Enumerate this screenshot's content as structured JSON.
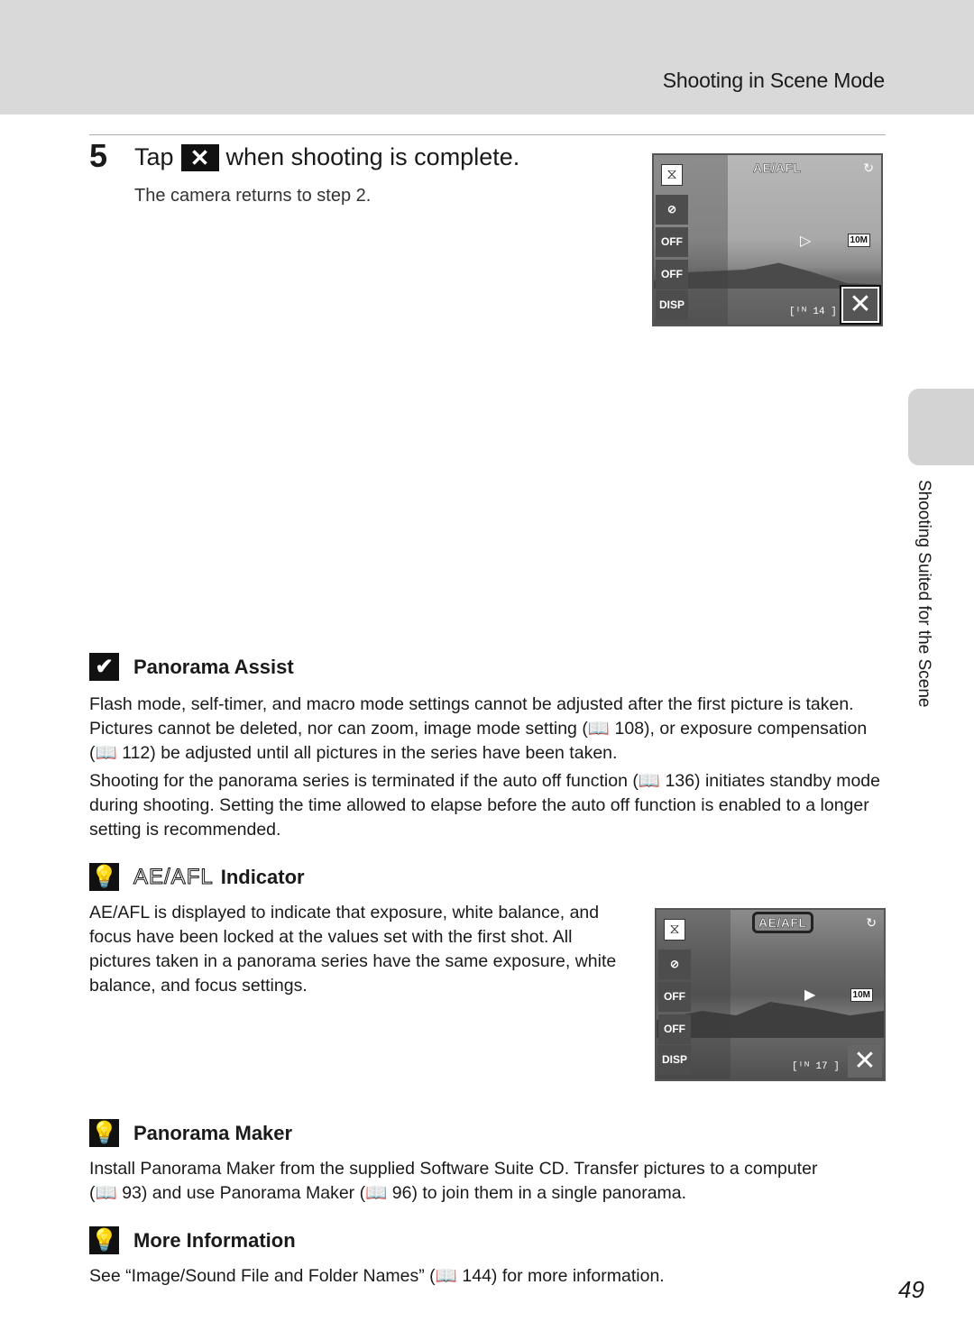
{
  "header": {
    "section_title": "Shooting in Scene Mode"
  },
  "step": {
    "number": "5",
    "title_before": "Tap",
    "title_icon": "✕",
    "title_after": "when shooting is complete.",
    "subtitle": "The camera returns to step 2."
  },
  "camera_screen_1": {
    "ae_label": "AE/AFL",
    "frames_remaining": "[ᴵᴺ  14 ]",
    "image_size": "10M",
    "tiles": [
      "panorama-icon",
      "flash-off-icon",
      "self-timer-off-icon",
      "macro-off-icon",
      "DISP"
    ],
    "disp_label": "DISP",
    "off_label": "OFF"
  },
  "camera_screen_2": {
    "ae_label": "AE/AFL",
    "frames_remaining": "[ᴵᴺ  17 ]",
    "image_size": "10M",
    "disp_label": "DISP",
    "off_label": "OFF"
  },
  "side_tab": {
    "label": "Shooting Suited for the Scene"
  },
  "sections": {
    "panorama_assist": {
      "title": "Panorama Assist",
      "paragraph_1": "Flash mode, self-timer, and macro mode settings cannot be adjusted after the first picture is taken. Pictures cannot be deleted, nor can zoom, image mode setting (📖 108), or exposure compensation (📖 112) be adjusted until all pictures in the series have been taken.",
      "paragraph_2": "Shooting for the panorama series is terminated if the auto off function (📖 136) initiates standby mode during shooting. Setting the time allowed to elapse before the auto off function is enabled to a longer setting is recommended."
    },
    "ae_indicator": {
      "title_glyph": "AE/AFL",
      "title": "Indicator",
      "paragraph": "AE/AFL is displayed to indicate that exposure, white balance, and focus have been locked at the values set with the first shot. All pictures taken in a panorama series have the same exposure, white balance, and focus settings."
    },
    "panorama_maker": {
      "title": "Panorama Maker",
      "paragraph": "Install Panorama Maker from the supplied Software Suite CD. Transfer pictures to a computer (📖 93) and use Panorama Maker (📖 96) to join them in a single panorama."
    },
    "more_information": {
      "title": "More Information",
      "paragraph": "See “Image/Sound File and Folder Names” (📖 144) for more information."
    }
  },
  "page_number": "49"
}
